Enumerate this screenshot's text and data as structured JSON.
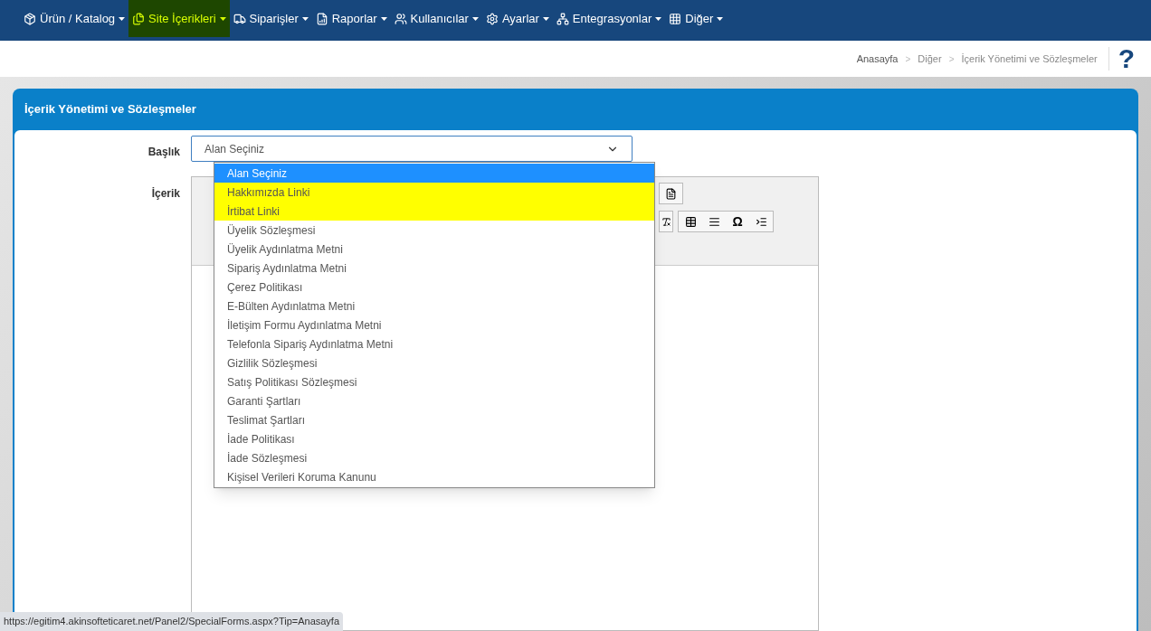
{
  "menu": [
    {
      "label": "Ürün / Katalog",
      "selected": false
    },
    {
      "label": "Site İçerikleri",
      "selected": true
    },
    {
      "label": "Siparişler",
      "selected": false
    },
    {
      "label": "Raporlar",
      "selected": false
    },
    {
      "label": "Kullanıcılar",
      "selected": false
    },
    {
      "label": "Ayarlar",
      "selected": false
    },
    {
      "label": "Entegrasyonlar",
      "selected": false
    },
    {
      "label": "Diğer",
      "selected": false
    }
  ],
  "breadcrumb": [
    "Anasayfa",
    "Diğer",
    "İçerik Yönetimi ve Sözleşmeler"
  ],
  "breadcrumb_separator": ">",
  "help": "?",
  "panel": {
    "title": "İçerik Yönetimi ve Sözleşmeler"
  },
  "form": {
    "title_label": "Başlık",
    "title_value": "Alan Seçiniz",
    "content_label": "İçerik",
    "options": [
      {
        "label": "Alan Seçiniz",
        "selected": true,
        "highlighted": false
      },
      {
        "label": "Hakkımızda Linki",
        "selected": false,
        "highlighted": true
      },
      {
        "label": "İrtibat Linki",
        "selected": false,
        "highlighted": true
      },
      {
        "label": "Üyelik Sözleşmesi",
        "selected": false,
        "highlighted": false
      },
      {
        "label": "Üyelik Aydınlatma Metni",
        "selected": false,
        "highlighted": false
      },
      {
        "label": "Sipariş Aydınlatma Metni",
        "selected": false,
        "highlighted": false
      },
      {
        "label": "Çerez Politikası",
        "selected": false,
        "highlighted": false
      },
      {
        "label": "E-Bülten Aydınlatma Metni",
        "selected": false,
        "highlighted": false
      },
      {
        "label": "İletişim Formu Aydınlatma Metni",
        "selected": false,
        "highlighted": false
      },
      {
        "label": "Telefonla Sipariş Aydınlatma Metni",
        "selected": false,
        "highlighted": false
      },
      {
        "label": "Gizlilik Sözleşmesi",
        "selected": false,
        "highlighted": false
      },
      {
        "label": "Satış Politikası Sözleşmesi",
        "selected": false,
        "highlighted": false
      },
      {
        "label": "Garanti Şartları",
        "selected": false,
        "highlighted": false
      },
      {
        "label": "Teslimat Şartları",
        "selected": false,
        "highlighted": false
      },
      {
        "label": "İade Politikası",
        "selected": false,
        "highlighted": false
      },
      {
        "label": "İade Sözleşmesi",
        "selected": false,
        "highlighted": false
      },
      {
        "label": "Kişisel Verileri Koruma Kanunu",
        "selected": false,
        "highlighted": false
      }
    ],
    "toolbar_symbol": "Ω"
  },
  "status_url": "https://egitim4.akinsofteticaret.net/Panel2/SpecialForms.aspx?Tip=Anasayfa"
}
